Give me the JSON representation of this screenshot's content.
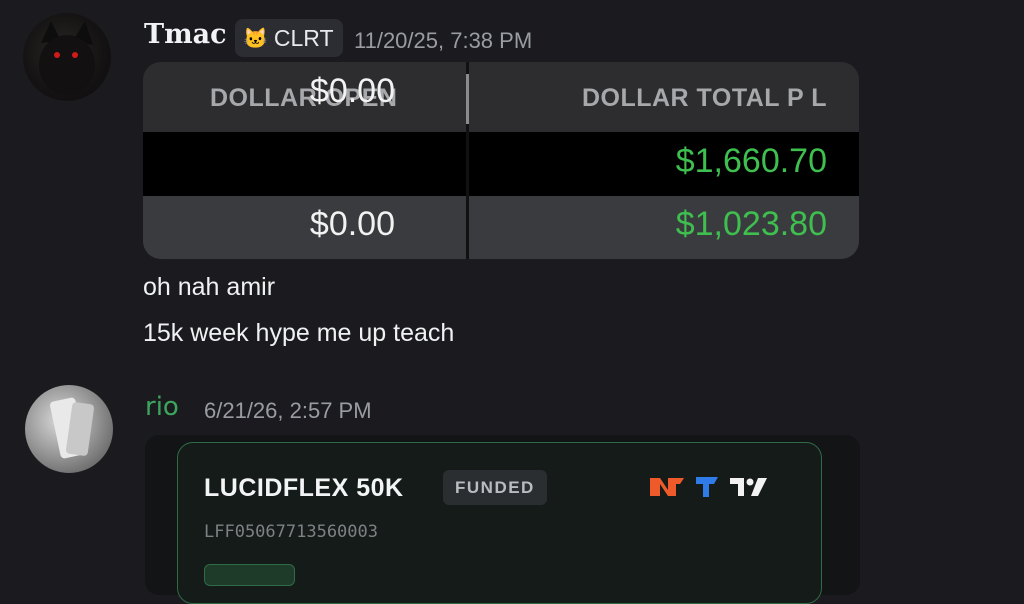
{
  "messages": [
    {
      "author": "Tmac",
      "tag": "CLRT",
      "timestamp": "11/20/25, 7:38 PM",
      "table": {
        "headers": [
          "DOLLAR OPEN",
          "DOLLAR TOTAL P L"
        ],
        "rows": [
          [
            "$0.00",
            "$1,660.70"
          ],
          [
            "$0.00",
            "$1,023.80"
          ]
        ]
      },
      "lines": [
        "oh nah amir",
        "15k week hype me up teach"
      ]
    },
    {
      "author": "rio",
      "timestamp": "6/21/26, 2:57 PM",
      "card": {
        "title": "LUCIDFLEX 50K",
        "badge": "FUNDED",
        "account_id": "LFF05067713560003"
      }
    }
  ],
  "colors": {
    "background": "#1b1b1f",
    "profit_green": "#3fbf4f",
    "rio_name": "#3ba55d",
    "card_border": "#2f6b47"
  },
  "icons": [
    "cat-tag-icon",
    "ninjatrader-logo-icon",
    "tradovate-logo-icon",
    "tradingview-logo-icon"
  ]
}
